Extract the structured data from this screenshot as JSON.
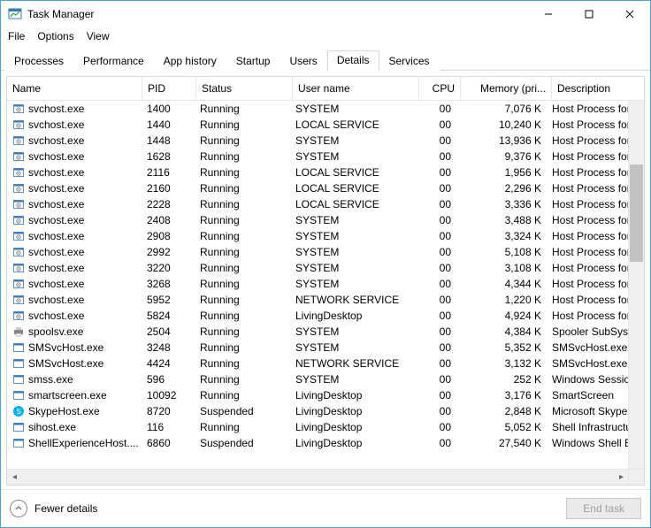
{
  "window": {
    "title": "Task Manager"
  },
  "menu": {
    "file": "File",
    "options": "Options",
    "view": "View"
  },
  "tabs": {
    "processes": "Processes",
    "performance": "Performance",
    "app_history": "App history",
    "startup": "Startup",
    "users": "Users",
    "details": "Details",
    "services": "Services"
  },
  "columns": {
    "name": "Name",
    "pid": "PID",
    "status": "Status",
    "user": "User name",
    "cpu": "CPU",
    "memory": "Memory (pri...",
    "description": "Description"
  },
  "footer": {
    "fewer": "Fewer details",
    "end_task": "End task"
  },
  "rows": [
    {
      "icon": "gear",
      "name": "svchost.exe",
      "pid": "1400",
      "status": "Running",
      "user": "SYSTEM",
      "cpu": "00",
      "mem": "7,076 K",
      "desc": "Host Process for Windows Serv"
    },
    {
      "icon": "gear",
      "name": "svchost.exe",
      "pid": "1440",
      "status": "Running",
      "user": "LOCAL SERVICE",
      "cpu": "00",
      "mem": "10,240 K",
      "desc": "Host Process for Windows Serv"
    },
    {
      "icon": "gear",
      "name": "svchost.exe",
      "pid": "1448",
      "status": "Running",
      "user": "SYSTEM",
      "cpu": "00",
      "mem": "13,936 K",
      "desc": "Host Process for Windows Serv"
    },
    {
      "icon": "gear",
      "name": "svchost.exe",
      "pid": "1628",
      "status": "Running",
      "user": "SYSTEM",
      "cpu": "00",
      "mem": "9,376 K",
      "desc": "Host Process for Windows Serv"
    },
    {
      "icon": "gear",
      "name": "svchost.exe",
      "pid": "2116",
      "status": "Running",
      "user": "LOCAL SERVICE",
      "cpu": "00",
      "mem": "1,956 K",
      "desc": "Host Process for Windows Serv"
    },
    {
      "icon": "gear",
      "name": "svchost.exe",
      "pid": "2160",
      "status": "Running",
      "user": "LOCAL SERVICE",
      "cpu": "00",
      "mem": "2,296 K",
      "desc": "Host Process for Windows Serv"
    },
    {
      "icon": "gear",
      "name": "svchost.exe",
      "pid": "2228",
      "status": "Running",
      "user": "LOCAL SERVICE",
      "cpu": "00",
      "mem": "3,336 K",
      "desc": "Host Process for Windows Serv"
    },
    {
      "icon": "gear",
      "name": "svchost.exe",
      "pid": "2408",
      "status": "Running",
      "user": "SYSTEM",
      "cpu": "00",
      "mem": "3,488 K",
      "desc": "Host Process for Windows Serv"
    },
    {
      "icon": "gear",
      "name": "svchost.exe",
      "pid": "2908",
      "status": "Running",
      "user": "SYSTEM",
      "cpu": "00",
      "mem": "3,324 K",
      "desc": "Host Process for Windows Serv"
    },
    {
      "icon": "gear",
      "name": "svchost.exe",
      "pid": "2992",
      "status": "Running",
      "user": "SYSTEM",
      "cpu": "00",
      "mem": "5,108 K",
      "desc": "Host Process for Windows Serv"
    },
    {
      "icon": "gear",
      "name": "svchost.exe",
      "pid": "3220",
      "status": "Running",
      "user": "SYSTEM",
      "cpu": "00",
      "mem": "3,108 K",
      "desc": "Host Process for Windows Serv"
    },
    {
      "icon": "gear",
      "name": "svchost.exe",
      "pid": "3268",
      "status": "Running",
      "user": "SYSTEM",
      "cpu": "00",
      "mem": "4,344 K",
      "desc": "Host Process for Windows Serv"
    },
    {
      "icon": "gear",
      "name": "svchost.exe",
      "pid": "5952",
      "status": "Running",
      "user": "NETWORK SERVICE",
      "cpu": "00",
      "mem": "1,220 K",
      "desc": "Host Process for Windows Serv"
    },
    {
      "icon": "gear",
      "name": "svchost.exe",
      "pid": "5824",
      "status": "Running",
      "user": "LivingDesktop",
      "cpu": "00",
      "mem": "4,924 K",
      "desc": "Host Process for Windows Serv"
    },
    {
      "icon": "printer",
      "name": "spoolsv.exe",
      "pid": "2504",
      "status": "Running",
      "user": "SYSTEM",
      "cpu": "00",
      "mem": "4,384 K",
      "desc": "Spooler SubSystem App"
    },
    {
      "icon": "app",
      "name": "SMSvcHost.exe",
      "pid": "3248",
      "status": "Running",
      "user": "SYSTEM",
      "cpu": "00",
      "mem": "5,352 K",
      "desc": "SMSvcHost.exe"
    },
    {
      "icon": "app",
      "name": "SMSvcHost.exe",
      "pid": "4424",
      "status": "Running",
      "user": "NETWORK SERVICE",
      "cpu": "00",
      "mem": "3,132 K",
      "desc": "SMSvcHost.exe"
    },
    {
      "icon": "app",
      "name": "smss.exe",
      "pid": "596",
      "status": "Running",
      "user": "SYSTEM",
      "cpu": "00",
      "mem": "252 K",
      "desc": "Windows Session Manager"
    },
    {
      "icon": "app",
      "name": "smartscreen.exe",
      "pid": "10092",
      "status": "Running",
      "user": "LivingDesktop",
      "cpu": "00",
      "mem": "3,176 K",
      "desc": "SmartScreen"
    },
    {
      "icon": "skype",
      "name": "SkypeHost.exe",
      "pid": "8720",
      "status": "Suspended",
      "user": "LivingDesktop",
      "cpu": "00",
      "mem": "2,848 K",
      "desc": "Microsoft Skype Preview"
    },
    {
      "icon": "app",
      "name": "sihost.exe",
      "pid": "116",
      "status": "Running",
      "user": "LivingDesktop",
      "cpu": "00",
      "mem": "5,052 K",
      "desc": "Shell Infrastructure Host"
    },
    {
      "icon": "app",
      "name": "ShellExperienceHost....",
      "pid": "6860",
      "status": "Suspended",
      "user": "LivingDesktop",
      "cpu": "00",
      "mem": "27,540 K",
      "desc": "Windows Shell Experience Hos"
    }
  ]
}
